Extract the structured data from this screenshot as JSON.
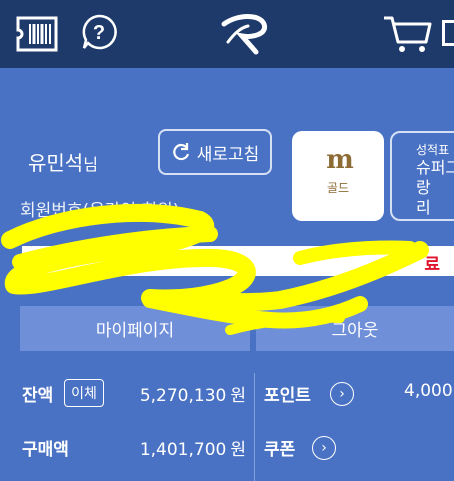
{
  "header": {
    "icons": [
      "ticket-icon",
      "help-icon",
      "brand-logo",
      "cart-icon",
      "menu-icon"
    ]
  },
  "user": {
    "name": "유민석",
    "suffix": "님",
    "refresh_label": "새로고침",
    "member_info": "회원번호(온라인 회원)"
  },
  "grade": {
    "label": "골드",
    "perf_title": "성적표",
    "perf_value": "슈퍼그랑\n리"
  },
  "notice": {
    "left_text": "0",
    "right_text": "료"
  },
  "tabs": {
    "mypage": "마이페이지",
    "logout": "그아웃"
  },
  "summary": {
    "balance_label": "잔액",
    "transfer_label": "이체",
    "balance_value": "5,270,130",
    "currency": "원",
    "point_label": "포인트",
    "point_value": "4,000",
    "purchase_label": "구매액",
    "purchase_value": "1,401,700",
    "coupon_label": "쿠폰"
  },
  "colors": {
    "header_bg": "#1e3a6b",
    "main_bg": "#4a72c4",
    "tab_bg": "#6f8fd8",
    "accent_red": "#e0142c",
    "gold": "#8d6b34",
    "highlight": "#ffff00"
  }
}
